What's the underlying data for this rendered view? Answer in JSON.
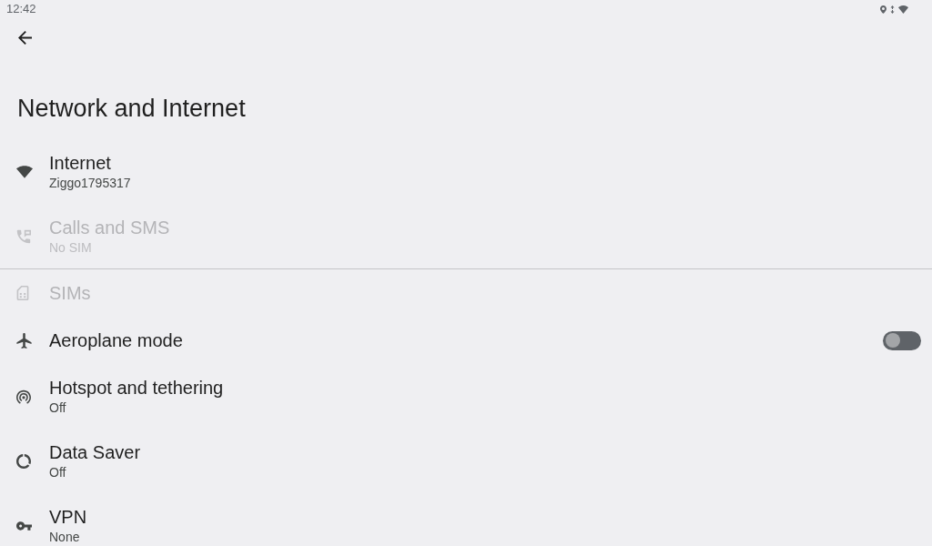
{
  "status_bar": {
    "time": "12:42"
  },
  "header": {
    "title": "Network and Internet"
  },
  "groups": [
    {
      "items": [
        {
          "kind": "link",
          "title": "Internet",
          "summary": "Ziggo1795317",
          "disabled": false
        },
        {
          "kind": "link",
          "title": "Calls and SMS",
          "summary": "No SIM",
          "disabled": true
        }
      ]
    },
    {
      "items": [
        {
          "kind": "link",
          "title": "SIMs",
          "disabled": true
        },
        {
          "kind": "switch",
          "title": "Aeroplane mode",
          "disabled": false,
          "on": false
        },
        {
          "kind": "link",
          "title": "Hotspot and tethering",
          "summary": "Off",
          "disabled": false
        },
        {
          "kind": "link",
          "title": "Data Saver",
          "summary": "Off",
          "disabled": false
        },
        {
          "kind": "link",
          "title": "VPN",
          "summary": "None",
          "disabled": false
        }
      ]
    }
  ]
}
